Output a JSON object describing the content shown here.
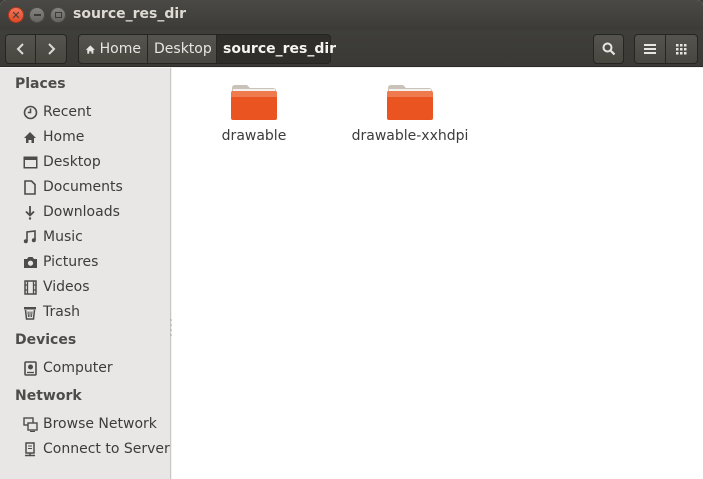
{
  "window": {
    "title": "source_res_dir"
  },
  "toolbar": {
    "breadcrumbs": [
      {
        "label": "Home"
      },
      {
        "label": "Desktop"
      },
      {
        "label": "source_res_dir"
      }
    ]
  },
  "sidebar": {
    "places_title": "Places",
    "places": [
      {
        "label": "Recent",
        "icon": "clock-icon"
      },
      {
        "label": "Home",
        "icon": "home-icon"
      },
      {
        "label": "Desktop",
        "icon": "desktop-icon"
      },
      {
        "label": "Documents",
        "icon": "document-icon"
      },
      {
        "label": "Downloads",
        "icon": "download-icon"
      },
      {
        "label": "Music",
        "icon": "music-icon"
      },
      {
        "label": "Pictures",
        "icon": "camera-icon"
      },
      {
        "label": "Videos",
        "icon": "film-icon"
      },
      {
        "label": "Trash",
        "icon": "trash-icon"
      }
    ],
    "devices_title": "Devices",
    "devices": [
      {
        "label": "Computer",
        "icon": "harddisk-icon"
      }
    ],
    "network_title": "Network",
    "network": [
      {
        "label": "Browse Network",
        "icon": "network-icon"
      },
      {
        "label": "Connect to Server",
        "icon": "server-icon"
      }
    ]
  },
  "content": {
    "folders": [
      {
        "label": "drawable"
      },
      {
        "label": "drawable-xxhdpi"
      }
    ]
  },
  "colors": {
    "folder_orange": "#e95420",
    "titlebar": "#3c3b37",
    "close_button": "#df4a27"
  }
}
